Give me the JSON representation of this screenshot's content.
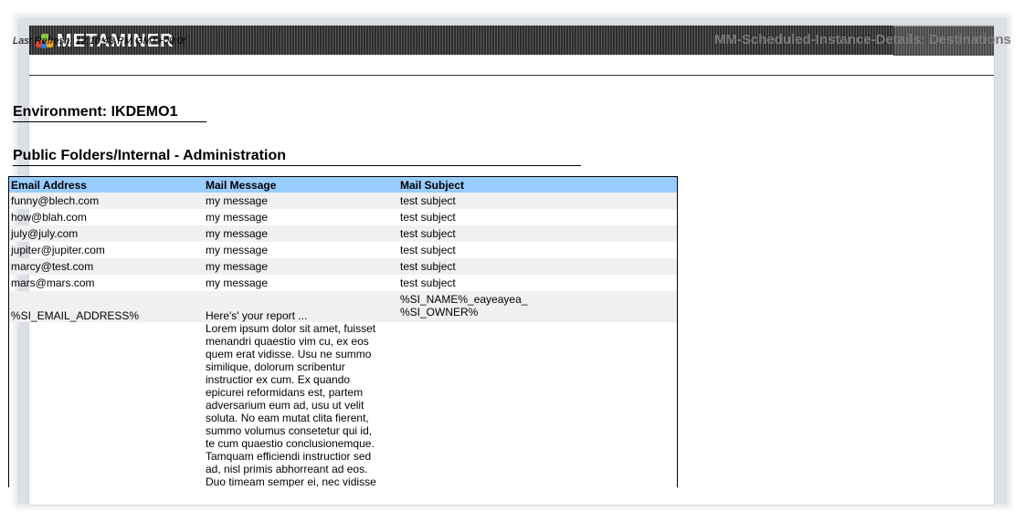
{
  "app": {
    "logo_text": "METAMINER"
  },
  "header": {
    "last_refresh": "Last Refresh: 12:10:43 PM GMT+00:0(",
    "report_title": "MM-Scheduled-Instance-Details: Destinations"
  },
  "environment": "Environment: IKDEMO1",
  "section_title": "Public Folders/Internal - Administration",
  "table": {
    "columns": [
      "Email Address",
      "Mail Message",
      "Mail Subject"
    ],
    "rows": [
      [
        "funny@blech.com",
        "my message",
        "test subject"
      ],
      [
        "how@blah.com",
        "my message",
        "test subject"
      ],
      [
        "july@july.com",
        "my message",
        "test subject"
      ],
      [
        "jupiter@jupiter.com",
        "my message",
        "test subject"
      ],
      [
        "marcy@test.com",
        "my message",
        "test subject"
      ],
      [
        "mars@mars.com",
        "my message",
        "test subject"
      ],
      [
        "%SI_EMAIL_ADDRESS%",
        "Here's' your report ...",
        "%SI_NAME%_eayeayea_\n%SI_OWNER%"
      ],
      [
        "",
        "Lorem ipsum dolor sit amet, fuisset\nmenandri quaestio vim cu, ex eos\nquem erat vidisse. Usu ne summo\nsimilique, dolorum scribentur\ninstructior ex cum. Ex quando\nepicurei reformidans est, partem\nadversarium eum ad, usu ut velit\nsoluta. No eam mutat clita fierent,\nsummo volumus consetetur qui id,\nte cum quaestio conclusionemque.\nTamquam efficiendi instructior sed\nad, nisl primis abhorreant ad eos.\nDuo timeam semper ei, nec vidisse",
        ""
      ]
    ]
  },
  "colors": {
    "header_bg": "#99ccff",
    "title_gray": "#7b7b7b",
    "banner": "#2d2d2d"
  }
}
